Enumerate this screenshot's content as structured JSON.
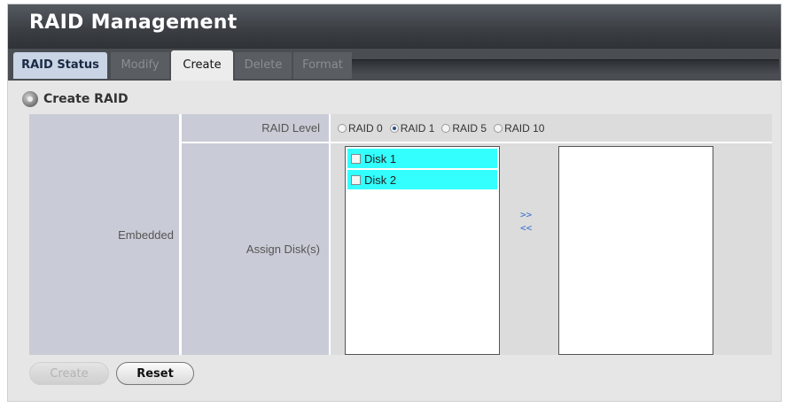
{
  "window": {
    "title": "RAID Management"
  },
  "tabs": [
    {
      "label": "RAID Status",
      "state": "normal"
    },
    {
      "label": "Modify",
      "state": "disabled"
    },
    {
      "label": "Create",
      "state": "active"
    },
    {
      "label": "Delete",
      "state": "disabled"
    },
    {
      "label": "Format",
      "state": "disabled"
    }
  ],
  "section": {
    "title": "Create RAID",
    "icon": "disk-icon"
  },
  "form": {
    "row_header": "Embedded",
    "raid_level": {
      "label": "RAID Level",
      "options": [
        {
          "label": "RAID 0",
          "selected": false
        },
        {
          "label": "RAID 1",
          "selected": true
        },
        {
          "label": "RAID 5",
          "selected": false
        },
        {
          "label": "RAID 10",
          "selected": false
        }
      ]
    },
    "assign": {
      "label": "Assign Disk(s)",
      "available_disks": [
        {
          "label": "Disk 1",
          "checked": false
        },
        {
          "label": "Disk 2",
          "checked": false
        }
      ],
      "assigned_disks": [],
      "add_label": ">>",
      "remove_label": "<<"
    }
  },
  "buttons": {
    "create_label": "Create",
    "create_enabled": false,
    "reset_label": "Reset"
  },
  "colors": {
    "tab_active": "#ececec",
    "disk_highlight": "#33ffff",
    "link": "#3a6fd0"
  }
}
